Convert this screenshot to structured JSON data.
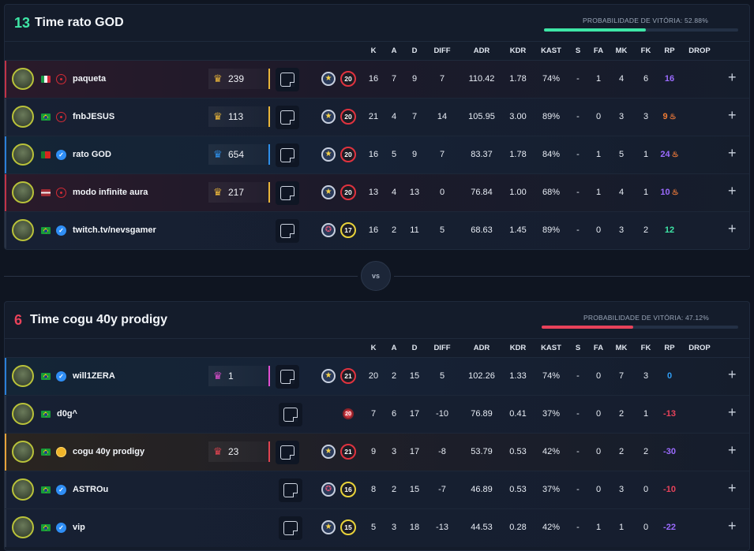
{
  "columns": [
    "K",
    "A",
    "D",
    "DIFF",
    "ADR",
    "KDR",
    "KAST",
    "S",
    "FA",
    "MK",
    "FK",
    "RP",
    "DROP"
  ],
  "prob_label": "PROBABILIDADE DE VITÓRIA:",
  "vs_label": "vs",
  "colors": {
    "green": "#3ee6a6",
    "red": "#e8425a",
    "purple": "#9b6bff",
    "orange": "#f07c34",
    "blue": "#2f9ef5",
    "light_green": "#3ee6a6"
  },
  "team1": {
    "score": "13",
    "name": "Time rato GOD",
    "prob_value": "52.88%",
    "prob_fraction": 0.5288,
    "players": [
      {
        "name": "paqueta",
        "flag": "it",
        "badge": "target",
        "rank": "239",
        "rank_color": "gold",
        "rank_icon": "crown-icon",
        "icon1": "star",
        "level": "20",
        "level_color": "red",
        "K": "16",
        "A": "7",
        "D": "9",
        "DIFF": "7",
        "ADR": "110.42",
        "KDR": "1.78",
        "KAST": "74%",
        "S": "-",
        "FA": "1",
        "MK": "4",
        "FK": "6",
        "RP": "16",
        "rp_color": "#9b6bff",
        "fire": false,
        "row_style": "red"
      },
      {
        "name": "fnbJESUS",
        "flag": "br",
        "badge": "target",
        "rank": "113",
        "rank_color": "gold",
        "rank_icon": "crown-icon",
        "icon1": "star",
        "level": "20",
        "level_color": "red",
        "K": "21",
        "A": "4",
        "D": "7",
        "DIFF": "14",
        "ADR": "105.95",
        "KDR": "3.00",
        "KAST": "89%",
        "S": "-",
        "FA": "0",
        "MK": "3",
        "FK": "3",
        "RP": "9",
        "rp_color": "#f07c34",
        "fire": true,
        "row_style": "dark"
      },
      {
        "name": "rato GOD",
        "flag": "pt",
        "badge": "verified",
        "rank": "654",
        "rank_color": "blue",
        "rank_icon": "crown-icon",
        "icon1": "star",
        "level": "20",
        "level_color": "red",
        "K": "16",
        "A": "5",
        "D": "9",
        "DIFF": "7",
        "ADR": "83.37",
        "KDR": "1.78",
        "KAST": "84%",
        "S": "-",
        "FA": "1",
        "MK": "5",
        "FK": "1",
        "RP": "24",
        "rp_color": "#9b6bff",
        "fire": true,
        "row_style": "blue"
      },
      {
        "name": "modo infinite aura",
        "flag": "lv",
        "badge": "target",
        "rank": "217",
        "rank_color": "gold",
        "rank_icon": "crown-icon",
        "icon1": "star",
        "level": "20",
        "level_color": "red",
        "K": "13",
        "A": "4",
        "D": "13",
        "DIFF": "0",
        "ADR": "76.84",
        "KDR": "1.00",
        "KAST": "68%",
        "S": "-",
        "FA": "1",
        "MK": "4",
        "FK": "1",
        "RP": "10",
        "rp_color": "#9b6bff",
        "fire": true,
        "row_style": "red"
      },
      {
        "name": "twitch.tv/nevsgamer",
        "flag": "br",
        "badge": "verified",
        "rank": "",
        "rank_color": "",
        "rank_icon": "",
        "icon1": "pink",
        "level": "17",
        "level_color": "yellow",
        "K": "16",
        "A": "2",
        "D": "11",
        "DIFF": "5",
        "ADR": "68.63",
        "KDR": "1.45",
        "KAST": "89%",
        "S": "-",
        "FA": "0",
        "MK": "3",
        "FK": "2",
        "RP": "12",
        "rp_color": "#3ee6a6",
        "fire": false,
        "row_style": "dark"
      }
    ]
  },
  "team2": {
    "score": "6",
    "name": "Time cogu 40y prodigy",
    "prob_value": "47.12%",
    "prob_fraction": 0.4712,
    "players": [
      {
        "name": "will1ZERA",
        "flag": "br",
        "badge": "verified",
        "rank": "1",
        "rank_color": "pink",
        "rank_icon": "crown-icon",
        "icon1": "star",
        "level": "21",
        "level_color": "red",
        "K": "20",
        "A": "2",
        "D": "15",
        "DIFF": "5",
        "ADR": "102.26",
        "KDR": "1.33",
        "KAST": "74%",
        "S": "-",
        "FA": "0",
        "MK": "7",
        "FK": "3",
        "RP": "0",
        "rp_color": "#2f9ef5",
        "fire": false,
        "row_style": "blue"
      },
      {
        "name": "d0g^",
        "flag": "br",
        "badge": "",
        "rank": "",
        "rank_color": "",
        "rank_icon": "",
        "icon1": "",
        "level": "20",
        "level_color": "solo",
        "K": "7",
        "A": "6",
        "D": "17",
        "DIFF": "-10",
        "ADR": "76.89",
        "KDR": "0.41",
        "KAST": "37%",
        "S": "-",
        "FA": "0",
        "MK": "2",
        "FK": "1",
        "RP": "-13",
        "rp_color": "#e8425a",
        "fire": false,
        "row_style": "dark"
      },
      {
        "name": "cogu 40y prodigy",
        "flag": "br",
        "badge": "gold",
        "rank": "23",
        "rank_color": "red",
        "rank_icon": "crown-icon",
        "icon1": "star",
        "level": "21",
        "level_color": "red",
        "K": "9",
        "A": "3",
        "D": "17",
        "DIFF": "-8",
        "ADR": "53.79",
        "KDR": "0.53",
        "KAST": "42%",
        "S": "-",
        "FA": "0",
        "MK": "2",
        "FK": "2",
        "RP": "-30",
        "rp_color": "#9b6bff",
        "fire": false,
        "row_style": "gold"
      },
      {
        "name": "ASTROu",
        "flag": "br",
        "badge": "verified",
        "rank": "",
        "rank_color": "",
        "rank_icon": "",
        "icon1": "pink",
        "level": "16",
        "level_color": "yellow",
        "K": "8",
        "A": "2",
        "D": "15",
        "DIFF": "-7",
        "ADR": "46.89",
        "KDR": "0.53",
        "KAST": "37%",
        "S": "-",
        "FA": "0",
        "MK": "3",
        "FK": "0",
        "RP": "-10",
        "rp_color": "#e8425a",
        "fire": false,
        "row_style": "dark"
      },
      {
        "name": "vip",
        "flag": "br",
        "badge": "verified",
        "rank": "",
        "rank_color": "",
        "rank_icon": "",
        "icon1": "star",
        "level": "15",
        "level_color": "yellow",
        "K": "5",
        "A": "3",
        "D": "18",
        "DIFF": "-13",
        "ADR": "44.53",
        "KDR": "0.28",
        "KAST": "42%",
        "S": "-",
        "FA": "1",
        "MK": "1",
        "FK": "0",
        "RP": "-22",
        "rp_color": "#9b6bff",
        "fire": false,
        "row_style": "dark"
      }
    ]
  }
}
